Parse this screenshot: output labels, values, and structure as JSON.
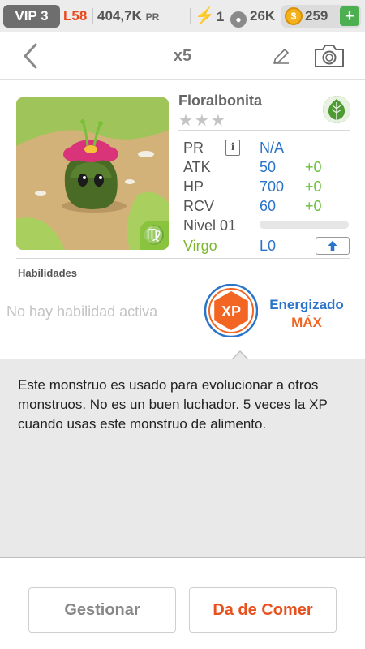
{
  "status_bar": {
    "vip": "VIP 3",
    "level": "L58",
    "power": "404,7K",
    "power_unit": "PR",
    "energy_icon": "lightning-icon",
    "energy": "1",
    "paw_icon": "paw-icon",
    "food": "26K",
    "coin_icon": "coin-icon",
    "coins": "259",
    "add_label": "+"
  },
  "header": {
    "back_icon": "chevron-left-icon",
    "title": "x5",
    "edit_icon": "pencil-icon",
    "camera_icon": "camera-icon"
  },
  "monster": {
    "name": "Floralbonita",
    "stars_total": 3,
    "stars_filled": 0,
    "stars": "★★★",
    "element_icon": "leaf-icon",
    "zodiac_badge": "♍",
    "stats": {
      "pr_label": "PR",
      "pr_value": "N/A",
      "atk_label": "ATK",
      "atk_value": "50",
      "atk_bonus": "+0",
      "hp_label": "HP",
      "hp_value": "700",
      "hp_bonus": "+0",
      "rcv_label": "RCV",
      "rcv_value": "60",
      "rcv_bonus": "+0"
    },
    "level_label": "Nivel 01",
    "level_progress": 0,
    "zodiac": "Virgo",
    "zodiac_level": "L0"
  },
  "abilities": {
    "title": "Habilidades",
    "empty_text": "No hay habilidad activa",
    "badge_text": "XP",
    "badge_label": "Energizado",
    "badge_value": "MÁX"
  },
  "description": "Este monstruo es usado para evolucionar a otros monstruos. No es un buen luchador. 5 veces la XP cuando usas este monstruo de alimento.",
  "buttons": {
    "manage": "Gestionar",
    "feed": "Da de Comer"
  },
  "colors": {
    "accent_blue": "#2a74c9",
    "accent_orange": "#f26522",
    "green": "#6abf3c"
  }
}
